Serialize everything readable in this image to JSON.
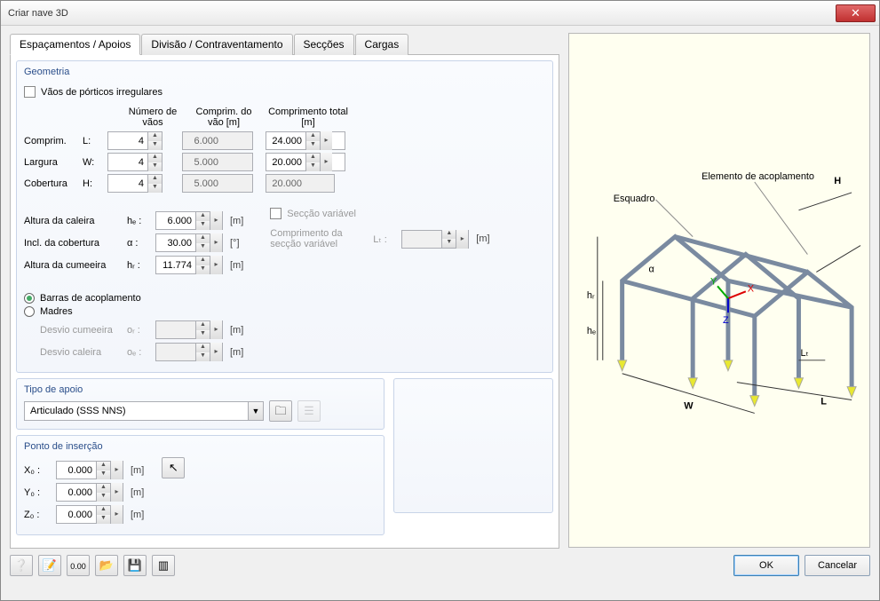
{
  "window": {
    "title": "Criar nave 3D"
  },
  "tabs": {
    "spacing": "Espaçamentos / Apoios",
    "division": "Divisão / Contraventamento",
    "sections": "Secções",
    "loads": "Cargas"
  },
  "geometry": {
    "title": "Geometria",
    "irregular_label": "Vãos de pórticos irregulares",
    "col_spans": "Número de vãos",
    "col_span_len": "Comprim. do vão [m]",
    "col_total_len": "Comprimento total [m]",
    "rows": {
      "length": {
        "label": "Comprim.",
        "sym": "L:",
        "spans": "4",
        "len": "6.000",
        "total": "24.000"
      },
      "width": {
        "label": "Largura",
        "sym": "W:",
        "spans": "4",
        "len": "5.000",
        "total": "20.000"
      },
      "roof": {
        "label": "Cobertura",
        "sym": "H:",
        "spans": "4",
        "len": "5.000",
        "total": "20.000"
      }
    },
    "eave_height": {
      "label": "Altura da caleira",
      "sym": "hₑ :",
      "val": "6.000",
      "unit": "[m]"
    },
    "roof_incl": {
      "label": "Incl. da cobertura",
      "sym": "α :",
      "val": "30.00",
      "unit": "[°]"
    },
    "ridge_height": {
      "label": "Altura da cumeeira",
      "sym": "hᵣ :",
      "val": "11.774",
      "unit": "[m]"
    },
    "var_section_label": "Secção variável",
    "var_section_len_label": "Comprimento da secção variável",
    "var_section_sym": "Lₜ :",
    "var_section_unit": "[m]",
    "coupling_opt": "Barras de acoplamento",
    "purlins_opt": "Madres",
    "off_ridge": {
      "label": "Desvio cumeeira",
      "sym": "oᵣ :",
      "unit": "[m]"
    },
    "off_eave": {
      "label": "Desvio caleira",
      "sym": "oₑ :",
      "unit": "[m]"
    }
  },
  "support": {
    "title": "Tipo de apoio",
    "value": "Articulado (SSS NNS)"
  },
  "insert": {
    "title": "Ponto de inserção",
    "x": {
      "label": "X₀ :",
      "val": "0.000",
      "unit": "[m]"
    },
    "y": {
      "label": "Y₀ :",
      "val": "0.000",
      "unit": "[m]"
    },
    "z": {
      "label": "Z₀ :",
      "val": "0.000",
      "unit": "[m]"
    }
  },
  "diagram_labels": {
    "coupling_el": "Elemento de acoplamento",
    "bracket": "Esquadro"
  },
  "buttons": {
    "ok": "OK",
    "cancel": "Cancelar"
  }
}
